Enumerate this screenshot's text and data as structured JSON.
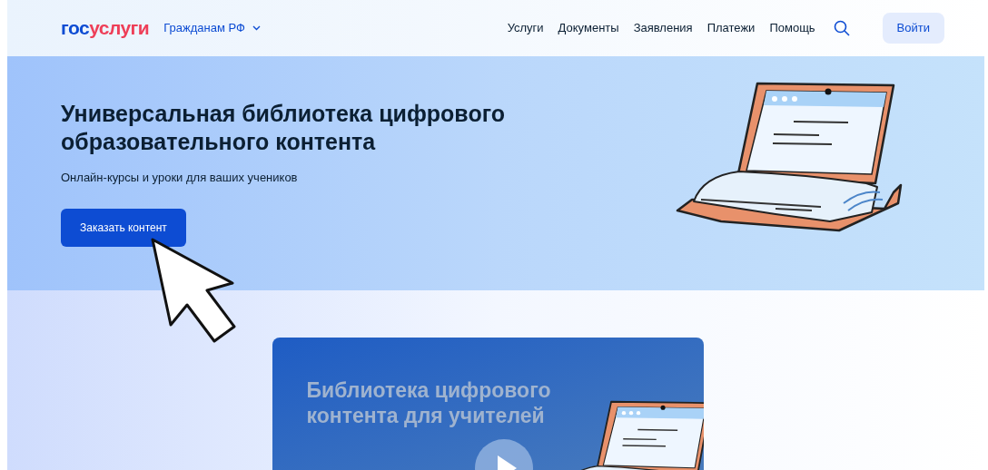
{
  "header": {
    "logo": {
      "parts": [
        "гос",
        "услуги"
      ]
    },
    "region": "Гражданам РФ",
    "nav": [
      "Услуги",
      "Документы",
      "Заявления",
      "Платежи",
      "Помощь"
    ],
    "login": "Войти"
  },
  "hero": {
    "title": "Универсальная библиотека цифрового образовательного контента",
    "subtitle": "Онлайн-курсы и уроки для ваших учеников",
    "button": "Заказать контент"
  },
  "video": {
    "title": "Библиотека цифрового контента для учителей"
  }
}
